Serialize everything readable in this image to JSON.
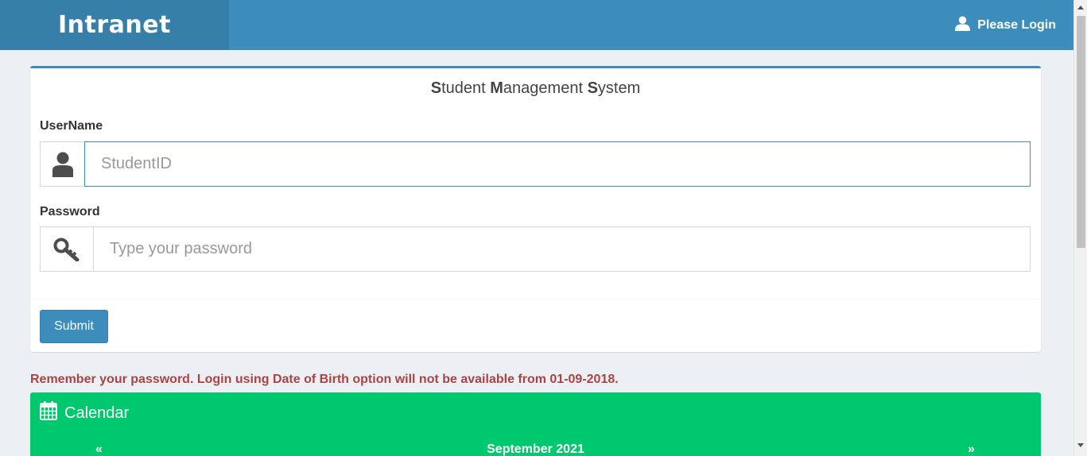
{
  "header": {
    "logo": "Intranet",
    "login_link": "Please Login"
  },
  "login_box": {
    "title_parts": [
      {
        "initial": "S",
        "rest": "tudent"
      },
      {
        "initial": "M",
        "rest": "anagement"
      },
      {
        "initial": "S",
        "rest": "ystem"
      }
    ],
    "username_label": "UserName",
    "username_placeholder": "StudentID",
    "password_label": "Password",
    "password_placeholder": "Type your password",
    "submit_label": "Submit"
  },
  "notice": "Remember your password. Login using Date of Birth option will not be available from 01-09-2018.",
  "calendar": {
    "title": "Calendar",
    "prev": "«",
    "month": "September 2021",
    "next": "»"
  },
  "colors": {
    "header_bg": "#3c8dbc",
    "logo_bg": "#367fa9",
    "notice": "#a94442",
    "calendar_bg": "#00c86e"
  },
  "icons": {
    "login": "user-icon",
    "username": "user-icon",
    "password": "key-icon",
    "calendar": "calendar-icon"
  }
}
